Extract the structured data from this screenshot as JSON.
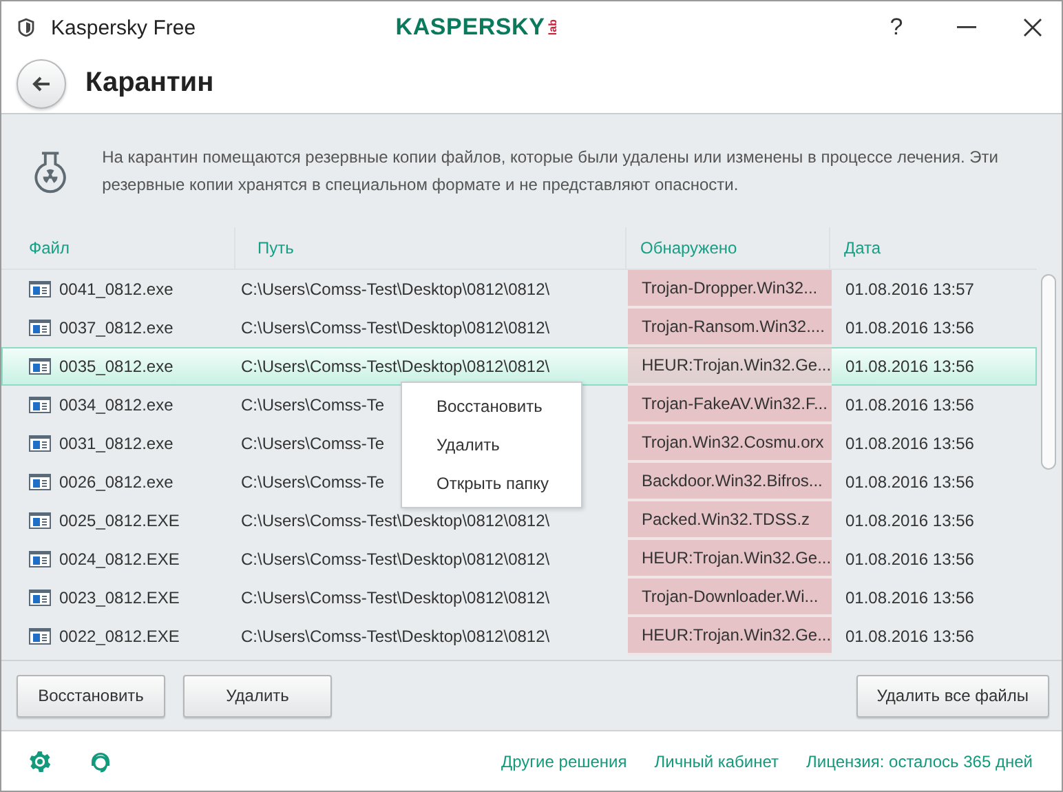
{
  "window": {
    "title": "Kaspersky Free",
    "logo": {
      "text": "KASPERSKY",
      "suffix": "lab"
    },
    "help": "?"
  },
  "page": {
    "title": "Карантин"
  },
  "info": {
    "text": "На карантин помещаются резервные копии файлов, которые были удалены или изменены в процессе лечения. Эти резервные копии хранятся в специальном формате и не представляют опасности."
  },
  "table": {
    "columns": [
      "Файл",
      "Путь",
      "Обнаружено",
      "Дата"
    ],
    "rows": [
      {
        "file": "0041_0812.exe",
        "path": "C:\\Users\\Comss-Test\\Desktop\\0812\\0812\\",
        "detected": "Trojan-Dropper.Win32...",
        "date": "01.08.2016 13:57",
        "selected": false
      },
      {
        "file": "0037_0812.exe",
        "path": "C:\\Users\\Comss-Test\\Desktop\\0812\\0812\\",
        "detected": "Trojan-Ransom.Win32....",
        "date": "01.08.2016 13:56",
        "selected": false
      },
      {
        "file": "0035_0812.exe",
        "path": "C:\\Users\\Comss-Test\\Desktop\\0812\\0812\\",
        "detected": "HEUR:Trojan.Win32.Ge...",
        "date": "01.08.2016 13:56",
        "selected": true
      },
      {
        "file": "0034_0812.exe",
        "path": "C:\\Users\\Comss-Te",
        "detected": "Trojan-FakeAV.Win32.F...",
        "date": "01.08.2016 13:56",
        "selected": false
      },
      {
        "file": "0031_0812.exe",
        "path": "C:\\Users\\Comss-Te",
        "detected": "Trojan.Win32.Cosmu.orx",
        "date": "01.08.2016 13:56",
        "selected": false
      },
      {
        "file": "0026_0812.exe",
        "path": "C:\\Users\\Comss-Te",
        "detected": "Backdoor.Win32.Bifros...",
        "date": "01.08.2016 13:56",
        "selected": false
      },
      {
        "file": "0025_0812.EXE",
        "path": "C:\\Users\\Comss-Test\\Desktop\\0812\\0812\\",
        "detected": "Packed.Win32.TDSS.z",
        "date": "01.08.2016 13:56",
        "selected": false
      },
      {
        "file": "0024_0812.EXE",
        "path": "C:\\Users\\Comss-Test\\Desktop\\0812\\0812\\",
        "detected": "HEUR:Trojan.Win32.Ge...",
        "date": "01.08.2016 13:56",
        "selected": false
      },
      {
        "file": "0023_0812.EXE",
        "path": "C:\\Users\\Comss-Test\\Desktop\\0812\\0812\\",
        "detected": "Trojan-Downloader.Wi...",
        "date": "01.08.2016 13:56",
        "selected": false
      },
      {
        "file": "0022_0812.EXE",
        "path": "C:\\Users\\Comss-Test\\Desktop\\0812\\0812\\",
        "detected": "HEUR:Trojan.Win32.Ge...",
        "date": "01.08.2016 13:56",
        "selected": false
      }
    ]
  },
  "context_menu": {
    "items": [
      "Восстановить",
      "Удалить",
      "Открыть папку"
    ]
  },
  "actions": {
    "left": [
      "Восстановить",
      "Удалить"
    ],
    "right": [
      "Удалить все файлы"
    ]
  },
  "footer": {
    "links": [
      "Другие решения",
      "Личный кабинет",
      "Лицензия: осталось 365 дней"
    ]
  }
}
